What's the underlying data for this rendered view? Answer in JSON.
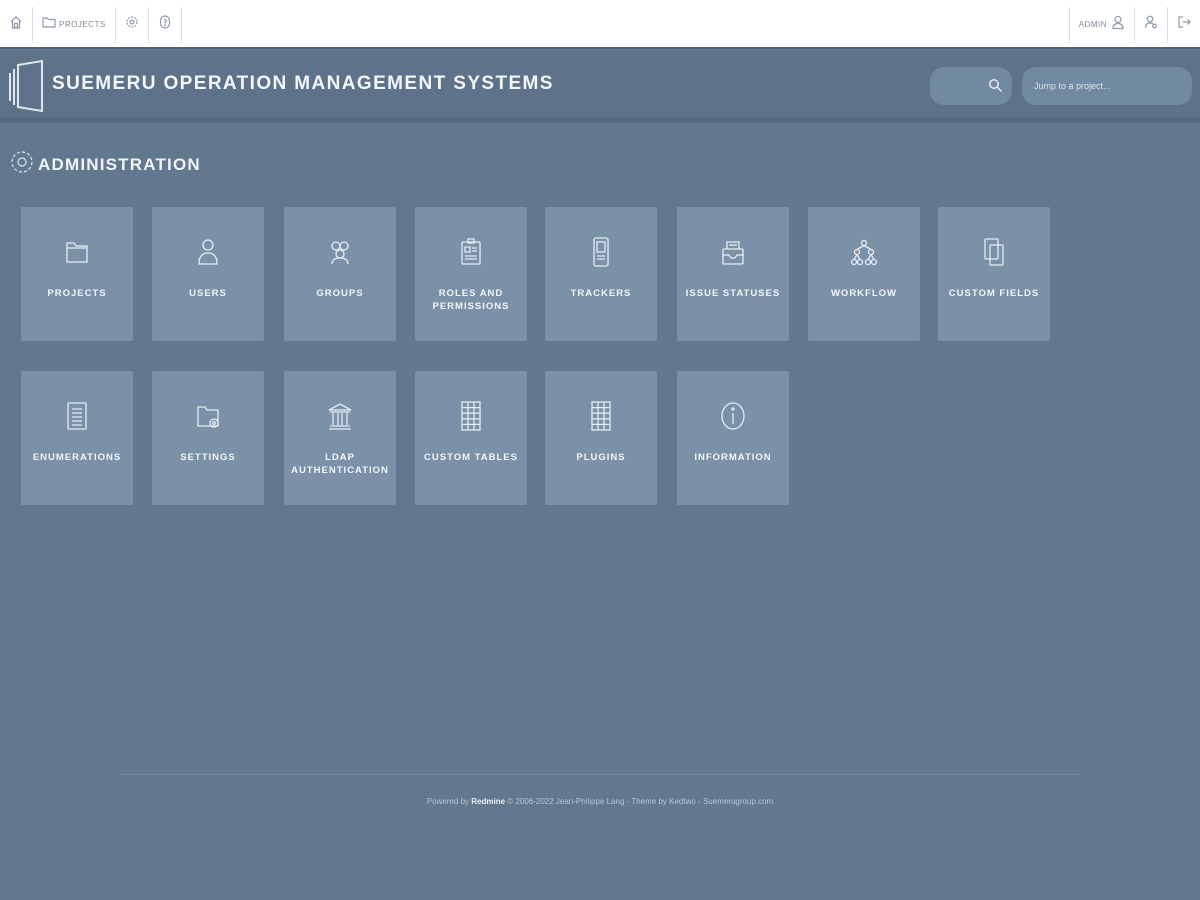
{
  "topbar": {
    "projects_label": "PROJECTS",
    "user_label": "ADMIN"
  },
  "header": {
    "title": "SUEMERU OPERATION MANAGEMENT SYSTEMS",
    "jump_placeholder": "Jump to a project..."
  },
  "page": {
    "title": "ADMINISTRATION"
  },
  "tiles": [
    {
      "label": "PROJECTS",
      "icon": "folder-icon"
    },
    {
      "label": "USERS",
      "icon": "user-icon"
    },
    {
      "label": "GROUPS",
      "icon": "group-icon"
    },
    {
      "label": "ROLES AND PERMISSIONS",
      "icon": "id-badge-icon"
    },
    {
      "label": "TRACKERS",
      "icon": "device-icon"
    },
    {
      "label": "ISSUE STATUSES",
      "icon": "inbox-icon"
    },
    {
      "label": "WORKFLOW",
      "icon": "sitemap-icon"
    },
    {
      "label": "CUSTOM FIELDS",
      "icon": "copy-icon"
    },
    {
      "label": "ENUMERATIONS",
      "icon": "list-icon"
    },
    {
      "label": "SETTINGS",
      "icon": "folder-gear-icon"
    },
    {
      "label": "LDAP AUTHENTICATION",
      "icon": "bank-icon"
    },
    {
      "label": "CUSTOM TABLES",
      "icon": "grid-icon"
    },
    {
      "label": "PLUGINS",
      "icon": "grid-icon"
    },
    {
      "label": "INFORMATION",
      "icon": "info-icon"
    }
  ],
  "footer": {
    "prefix": "Powered by",
    "brand": "Redmine",
    "suffix": "© 2006-2022 Jean-Philippe Lang - Theme by Kedtwo - Suemerugroup.com"
  }
}
